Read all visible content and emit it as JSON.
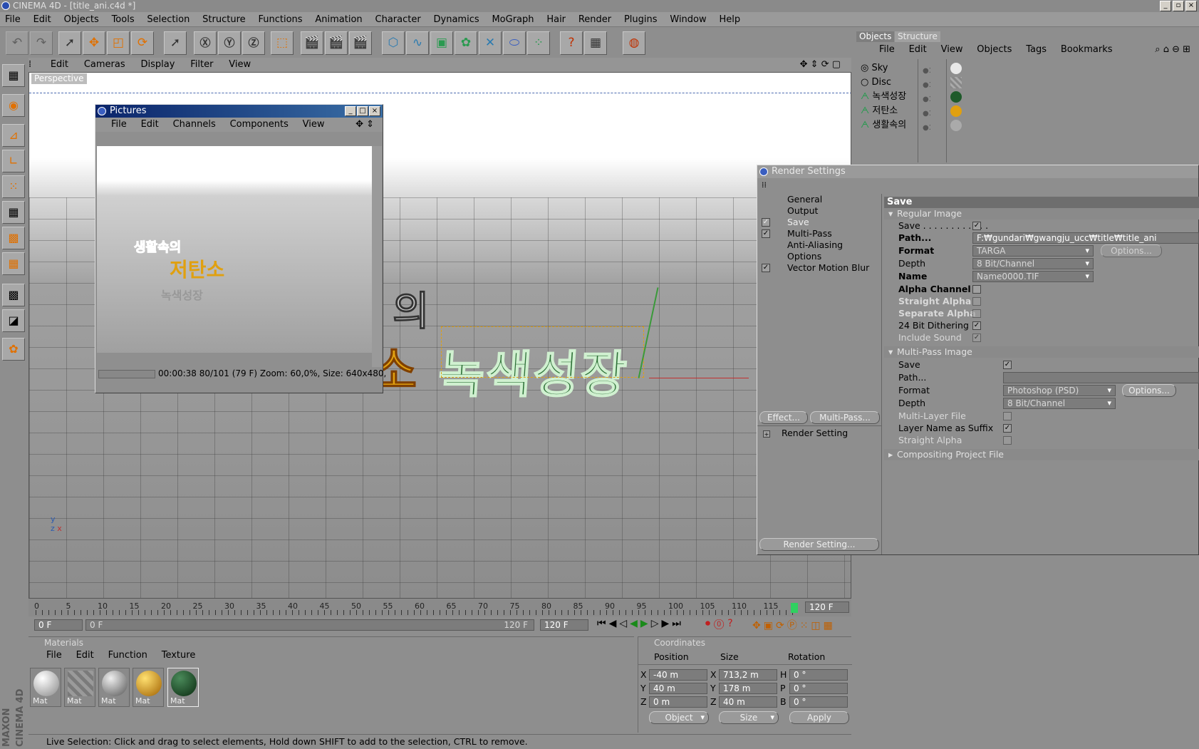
{
  "app": {
    "title": "CINEMA 4D - [title_ani.c4d *]"
  },
  "menu": [
    "File",
    "Edit",
    "Objects",
    "Tools",
    "Selection",
    "Structure",
    "Functions",
    "Animation",
    "Character",
    "Dynamics",
    "MoGraph",
    "Hair",
    "Render",
    "Plugins",
    "Window",
    "Help"
  ],
  "viewport": {
    "menu": [
      "Edit",
      "Cameras",
      "Display",
      "Filter",
      "View"
    ],
    "label": "Perspective",
    "scene_text": {
      "word1": "녹색성장",
      "word2": "소",
      "word3": "의"
    }
  },
  "pictures": {
    "title": "Pictures",
    "menu": [
      "File",
      "Edit",
      "Channels",
      "Components",
      "View"
    ],
    "status": "00:00:38 80/101 (79 F)  Zoom: 60,0%, Size: 640x480,",
    "preview_text": {
      "line1": "생활속의",
      "line2": "저탄소",
      "line3": "녹색성장"
    }
  },
  "objects": {
    "tabs": [
      "Objects",
      "Structure"
    ],
    "menu": [
      "File",
      "Edit",
      "View",
      "Objects",
      "Tags",
      "Bookmarks"
    ],
    "items": [
      "Sky",
      "Disc",
      "녹색성장",
      "저탄소",
      "생활속의"
    ]
  },
  "render_settings": {
    "title": "Render Settings",
    "sections": [
      {
        "label": "General",
        "checked": false
      },
      {
        "label": "Output",
        "checked": false
      },
      {
        "label": "Save",
        "checked": true
      },
      {
        "label": "Multi-Pass",
        "checked": true
      },
      {
        "label": "Anti-Aliasing",
        "checked": false
      },
      {
        "label": "Options",
        "checked": false
      },
      {
        "label": "Vector Motion Blur",
        "checked": true
      }
    ],
    "effect_button": "Effect...",
    "multipass_button": "Multi-Pass...",
    "render_setting_item": "Render Setting",
    "render_setting_button": "Render Setting...",
    "panel_title": "Save",
    "regular_image": {
      "header": "Regular Image",
      "save_label": "Save",
      "path_label": "Path...",
      "path_value": "F:₩gundari₩gwangju_ucc₩title₩title_ani",
      "format_label": "Format",
      "format_value": "TARGA",
      "options_button": "Options...",
      "depth_label": "Depth",
      "depth_value": "8 Bit/Channel",
      "name_label": "Name",
      "name_value": "Name0000.TIF",
      "alpha_label": "Alpha Channel",
      "straight_label": "Straight Alpha",
      "separate_label": "Separate Alpha",
      "dither_label": "24 Bit Dithering",
      "sound_label": "Include Sound"
    },
    "multipass_image": {
      "header": "Multi-Pass Image",
      "save_label": "Save",
      "path_label": "Path...",
      "format_label": "Format",
      "format_value": "Photoshop (PSD)",
      "options_button": "Options...",
      "depth_label": "Depth",
      "depth_value": "8 Bit/Channel",
      "multilayer_label": "Multi-Layer File",
      "suffix_label": "Layer Name as Suffix",
      "straight_label": "Straight Alpha"
    },
    "compositing": "Compositing Project File"
  },
  "timeline": {
    "ticks": [
      "0",
      "5",
      "10",
      "15",
      "20",
      "25",
      "30",
      "35",
      "40",
      "45",
      "50",
      "55",
      "60",
      "65",
      "70",
      "75",
      "80",
      "85",
      "90",
      "95",
      "100",
      "105",
      "110",
      "115"
    ],
    "end_frame": "120 F",
    "start_field": "0 F",
    "range_start": "0 F",
    "range_end": "120 F",
    "max_field": "120 F"
  },
  "materials": {
    "header": "Materials",
    "menu": [
      "File",
      "Edit",
      "Function",
      "Texture"
    ],
    "items": [
      {
        "label": "Mat",
        "color": "#e0e0e0"
      },
      {
        "label": "Mat",
        "color": "striped"
      },
      {
        "label": "Mat",
        "color": "#a8a8a8"
      },
      {
        "label": "Mat",
        "color": "#e0a010"
      },
      {
        "label": "Mat",
        "color": "#1e5a2a"
      }
    ]
  },
  "coordinates": {
    "header": "Coordinates",
    "cols": [
      "Position",
      "Size",
      "Rotation"
    ],
    "rows": [
      {
        "axis": "X",
        "pos": "-40 m",
        "saxis": "X",
        "size": "713,2 m",
        "raxis": "H",
        "rot": "0 °"
      },
      {
        "axis": "Y",
        "pos": "40 m",
        "saxis": "Y",
        "size": "178 m",
        "raxis": "P",
        "rot": "0 °"
      },
      {
        "axis": "Z",
        "pos": "0 m",
        "saxis": "Z",
        "size": "40 m",
        "raxis": "B",
        "rot": "0 °"
      }
    ],
    "mode": "Object",
    "size_mode": "Size",
    "apply": "Apply"
  },
  "status": "Live Selection: Click and drag to select elements, Hold down SHIFT to add to the selection, CTRL to remove.",
  "brand": "MAXON CINEMA 4D"
}
